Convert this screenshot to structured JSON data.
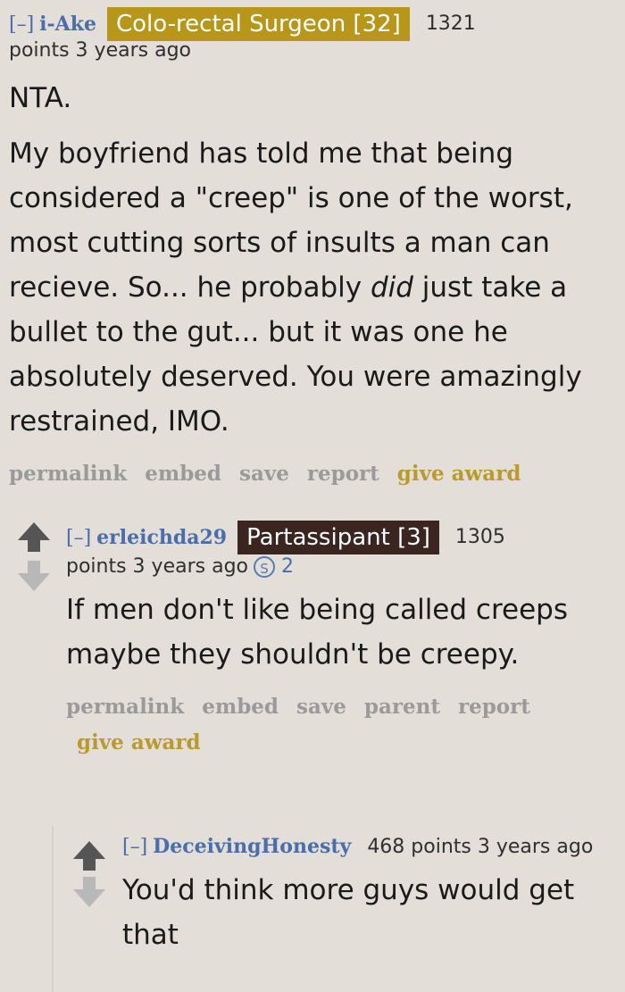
{
  "comments": [
    {
      "toggle": "[–]",
      "author": "i-Ake",
      "flair": "Colo-rectal Surgeon [32]",
      "flair_color": "#b8961a",
      "score": "1321",
      "meta": "points 3 years ago",
      "paragraphs": [
        "NTA."
      ],
      "body_parts": [
        "My boyfriend has told me that being considered a \"creep\" is one of the worst, most cutting sorts of insults a man can recieve. So... he probably ",
        "did",
        " just take a bullet to the gut... but it was one he absolutely deserved. You were amazingly restrained, IMO."
      ],
      "buttons": [
        "permalink",
        "embed",
        "save",
        "report",
        "give award"
      ]
    },
    {
      "toggle": "[–]",
      "author": "erleichda29",
      "flair": "Partassipant [3]",
      "flair_color": "#3a2520",
      "score": "1305",
      "meta": "points 3 years ago",
      "gild_icon": "silver-award-icon",
      "gild_count": "2",
      "paragraphs": [
        "If men don't like being called creeps maybe they shouldn't be creepy."
      ],
      "buttons": [
        "permalink",
        "embed",
        "save",
        "parent",
        "report",
        "give award"
      ]
    },
    {
      "toggle": "[–]",
      "author": "DeceivingHonesty",
      "score_meta": "468 points 3 years ago",
      "paragraphs": [
        "You'd think more guys would get that"
      ]
    }
  ]
}
